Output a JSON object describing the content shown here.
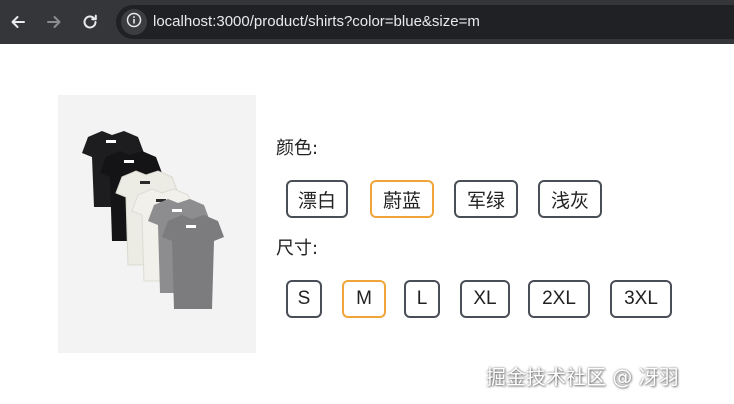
{
  "browser": {
    "url": "localhost:3000/product/shirts?color=blue&size=m",
    "icons": {
      "back": "arrow-left-icon",
      "forward": "arrow-right-icon",
      "reload": "reload-icon",
      "site_info": "info-icon"
    }
  },
  "product": {
    "image_alt_icon": "tshirt-stack-image",
    "color": {
      "label": "颜色:",
      "options": [
        "漂白",
        "蔚蓝",
        "军绿",
        "浅灰"
      ],
      "selected": "蔚蓝"
    },
    "size": {
      "label": "尺寸:",
      "options": [
        "S",
        "M",
        "L",
        "XL",
        "2XL",
        "3XL"
      ],
      "selected": "M"
    }
  },
  "watermark": "掘金技术社区 @ 冴羽",
  "colors": {
    "toolbar_bg": "#35363a",
    "omnibox_bg": "#202124",
    "selected_border": "#f0a53a",
    "default_border": "#4a4f57"
  }
}
